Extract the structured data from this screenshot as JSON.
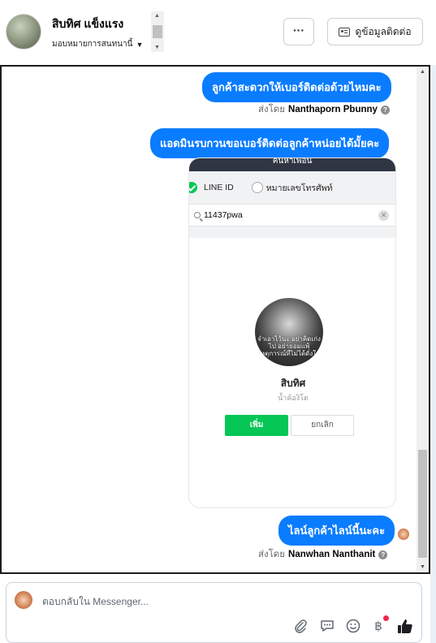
{
  "header": {
    "contact_name": "สิบทิศ แข็งแรง",
    "assign_label": "มอบหมายการสนทนานี้",
    "more_label": "···",
    "contact_info_label": "ดูข้อมูลติดต่อ"
  },
  "messages": [
    {
      "text": "ลูกค้าสะดวกให้เบอร์ติดต่อด้วยไหมคะ",
      "sent_by_prefix": "ส่งโดย",
      "sender": "Nanthaporn Pbunny"
    },
    {
      "text": "แอดมินรบกวนขอเบอร์ติดต่อลูกค้าหน่อยได้มั้ยคะ"
    },
    {
      "text": "ไลน์ลูกค้าไลน์นี้นะคะ",
      "sent_by_prefix": "ส่งโดย",
      "sender": "Nanwhan Nanthanit"
    }
  ],
  "line_screenshot": {
    "top_bar": "ค้นหาเพื่อน",
    "option_line_id": "LINE ID",
    "option_phone": "หมายเลขโทรศัพท์",
    "search_value": "11437pwa",
    "profile_image_text": "จำเอาไว้นะ อย่าคิดเก่งไป อย่ายอมแพ้ เหตุการณ์ที่ไม่ได้ดั่งใจ",
    "profile_name": "สิบทิศ",
    "profile_status": "น้ำค้องิโต",
    "add_button": "เพิ่ม",
    "cancel_button": "ยกเลิก"
  },
  "composer": {
    "placeholder": "ตอบกลับใน Messenger...",
    "tools": [
      "paperclip-icon",
      "chat-bubble-icon",
      "emoji-icon",
      "baht-icon",
      "thumbs-up-icon"
    ]
  },
  "colors": {
    "bubble": "#0a7cff",
    "line_green": "#06c755",
    "notification": "#f02849"
  }
}
